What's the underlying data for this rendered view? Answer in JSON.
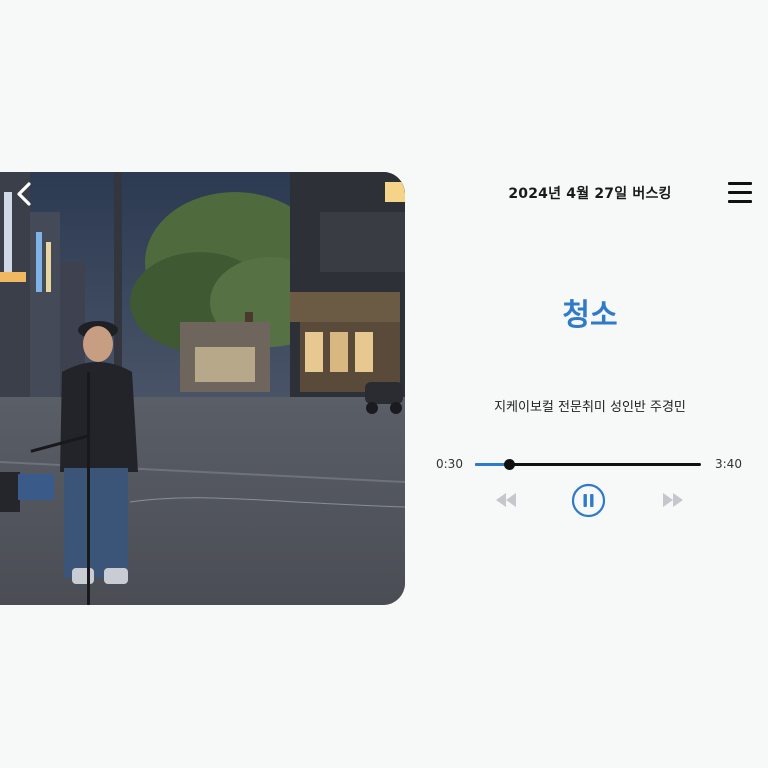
{
  "header": {
    "date_title": "2024년 4월 27일 버스킹",
    "back_icon": "chevron-left-icon",
    "menu_icon": "hamburger-menu-icon"
  },
  "track": {
    "title": "청소",
    "artist": "지케이보컬 전문취미 성인반 주경민"
  },
  "player": {
    "current_time": "0:30",
    "total_time": "3:40",
    "progress_fraction": 0.15,
    "state": "playing",
    "prev_icon": "rewind-icon",
    "pause_icon": "pause-icon",
    "next_icon": "fast-forward-icon"
  },
  "colors": {
    "accent": "#2f7ac9",
    "disabled_control": "#c4c7cb"
  }
}
